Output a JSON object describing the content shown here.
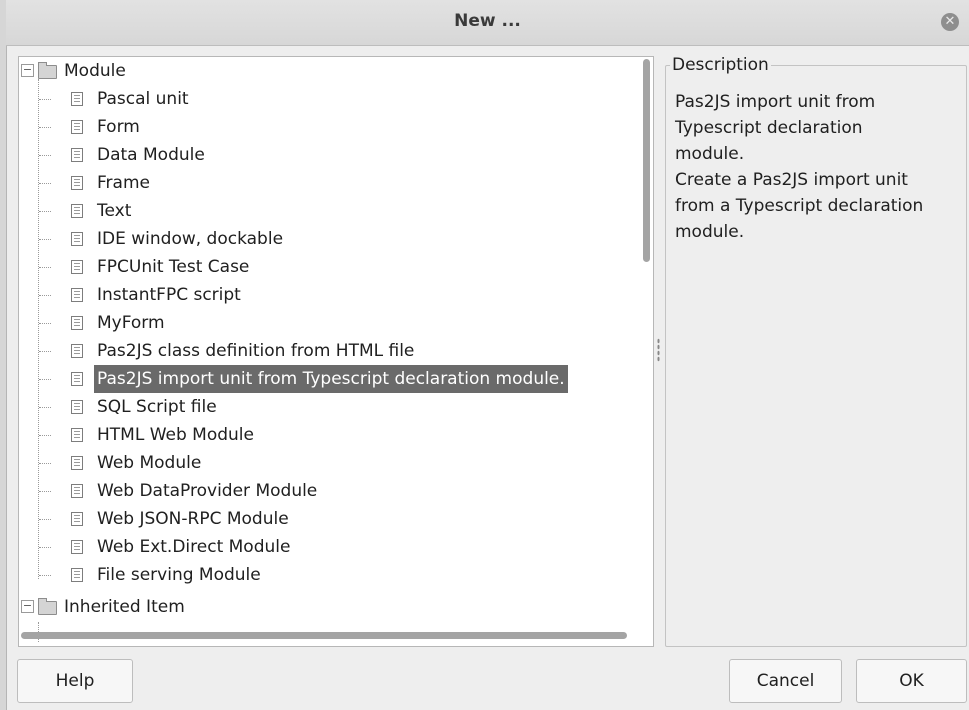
{
  "dialog": {
    "title": "New ..."
  },
  "tree": {
    "root_items": [
      {
        "label": "Module",
        "expanded": true,
        "children": [
          "Pascal unit",
          "Form",
          "Data Module",
          "Frame",
          "Text",
          "IDE window, dockable",
          "FPCUnit Test Case",
          "InstantFPC script",
          "MyForm",
          "Pas2JS class definition from HTML file",
          "Pas2JS import unit from Typescript declaration module.",
          "SQL Script file",
          "HTML Web Module",
          "Web Module",
          "Web DataProvider Module",
          "Web JSON-RPC Module",
          "Web Ext.Direct Module",
          "File serving Module"
        ]
      },
      {
        "label": "Inherited Item",
        "expanded": true,
        "children": []
      }
    ],
    "selected_label": "Pas2JS import unit from Typescript declaration module."
  },
  "description": {
    "legend": "Description",
    "lines": [
      "Pas2JS import unit from",
      "Typescript declaration",
      "module.",
      "Create a Pas2JS import unit",
      "from a Typescript declaration",
      "module."
    ]
  },
  "buttons": {
    "help": "Help",
    "cancel": "Cancel",
    "ok": "OK"
  },
  "colors": {
    "selection": "#6a6a6a",
    "window_bg": "#eeeeee"
  },
  "icons": {
    "close": "close-circle-icon",
    "folder": "folder-icon",
    "file": "document-icon",
    "expander": "minus-box-icon"
  }
}
